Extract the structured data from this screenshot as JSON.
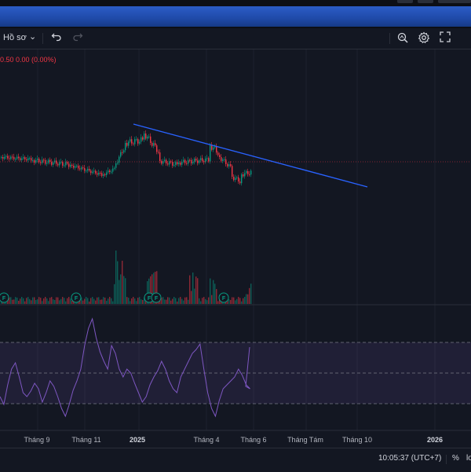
{
  "toolbar": {
    "profile_label": "Hồ sơ",
    "chevron": "⌄",
    "undo_icon": "undo-icon",
    "redo_icon": "redo-icon",
    "search_icon": "zoom-search-icon",
    "settings_icon": "gear-icon",
    "fullscreen_icon": "fullscreen-icon"
  },
  "legend": {
    "text": "0.50  0.00 (0.00%)"
  },
  "time_axis": {
    "labels": [
      "Tháng 9",
      "Tháng 11",
      "2025",
      "Tháng 4",
      "Tháng 6",
      "Tháng Tám",
      "Tháng 10",
      "2026"
    ]
  },
  "events": {
    "badge": "F"
  },
  "status": {
    "clock": "10:05:37 (UTC+7)",
    "percent": "%",
    "log_partial": "lo"
  },
  "colors": {
    "background": "#131722",
    "up": "#089981",
    "down": "#f23645",
    "trendline": "#2962ff",
    "rsi": "#7e57c2",
    "rsi_band": "#7e57c2"
  },
  "chart_data": {
    "type": "candlestick",
    "panes": [
      "price",
      "volume",
      "rsi"
    ],
    "x_axis": [
      "Tháng 9",
      "Tháng 11",
      "2025",
      "Tháng 4",
      "Tháng 6",
      "Tháng Tám",
      "Tháng 10",
      "2026"
    ],
    "rsi": {
      "upper_band": 70,
      "middle": 50,
      "lower_band": 30
    },
    "trendline": {
      "direction": "descending"
    },
    "grid": true
  }
}
